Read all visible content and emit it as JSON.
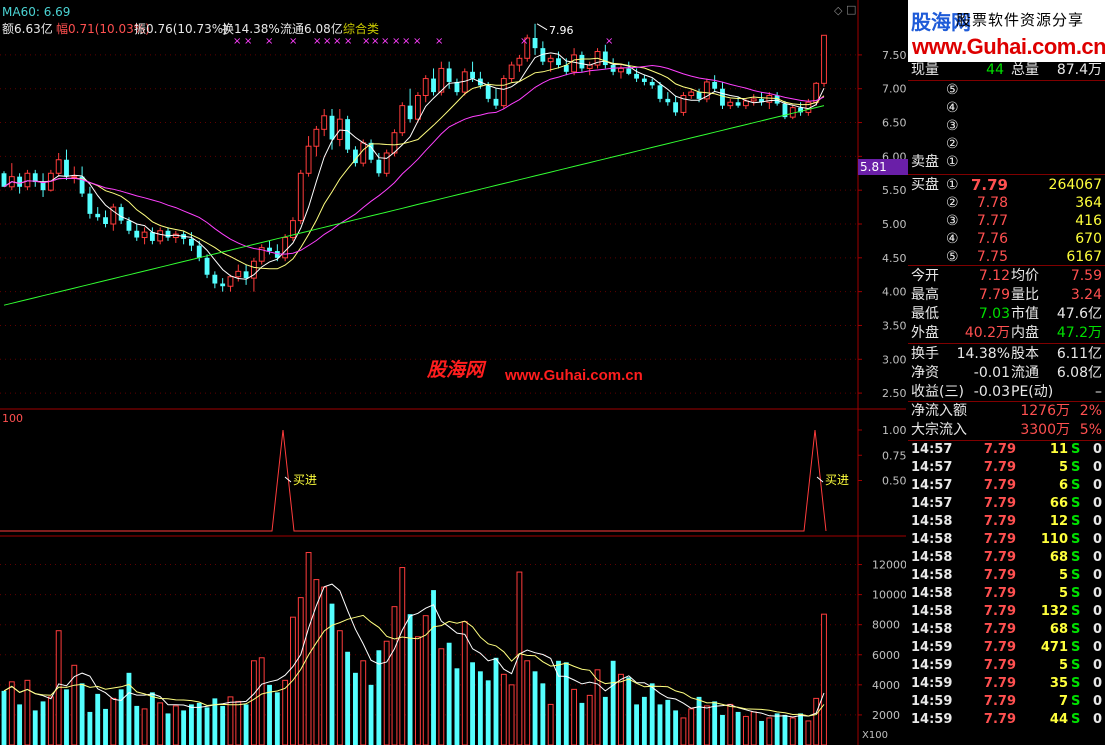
{
  "top_bar": {
    "ma60": "MA60: 6.69",
    "amount": "额6.63亿",
    "change": "幅0.71(10.03%)",
    "amplitude": "振0.76(10.73%)",
    "turnover": "换14.38%",
    "float": "流通6.08亿",
    "sector": "综合类"
  },
  "price_axis": [
    "7.50",
    "7.00",
    "6.50",
    "6.00",
    "5.50",
    "5.00",
    "4.50",
    "4.00",
    "3.50",
    "3.00",
    "2.50"
  ],
  "price_marker": "5.81",
  "high_label": "7.96",
  "indicator": {
    "label": "100",
    "axis": [
      "1.00",
      "0.75",
      "0.50"
    ],
    "signal_text": "买进",
    "signal_color": "#ffff3c"
  },
  "volume": {
    "axis": [
      "12000",
      "10000",
      "8000",
      "6000",
      "4000",
      "2000"
    ],
    "unit": "X100"
  },
  "watermark": {
    "cn": "股海网",
    "url": "www.Guhai.com.cn"
  },
  "logo": {
    "cn": "股海网",
    "tag": "股票软件资源分享",
    "url": "www.Guhai.com.cn"
  },
  "quote": {
    "volume_label": "现量",
    "volume_value": "44",
    "total_label": "总量",
    "total_value": "87.4万",
    "sell_label": "卖盘",
    "sell_levels": [
      "⑤",
      "④",
      "③",
      "②",
      "①"
    ],
    "buy_label": "买盘",
    "buy_levels": [
      {
        "lv": "①",
        "price": "7.79",
        "qty": "264067"
      },
      {
        "lv": "②",
        "price": "7.78",
        "qty": "364"
      },
      {
        "lv": "③",
        "price": "7.77",
        "qty": "416"
      },
      {
        "lv": "④",
        "price": "7.76",
        "qty": "670"
      },
      {
        "lv": "⑤",
        "price": "7.75",
        "qty": "6167"
      }
    ]
  },
  "stats": [
    {
      "l1": "今开",
      "v1": "7.12",
      "c1": "r",
      "l2": "均价",
      "v2": "7.59",
      "c2": "r"
    },
    {
      "l1": "最高",
      "v1": "7.79",
      "c1": "r",
      "l2": "量比",
      "v2": "3.24",
      "c2": "r"
    },
    {
      "l1": "最低",
      "v1": "7.03",
      "c1": "g",
      "l2": "市值",
      "v2": "47.6亿",
      "c2": "w"
    },
    {
      "l1": "外盘",
      "v1": "40.2万",
      "c1": "r",
      "l2": "内盘",
      "v2": "47.2万",
      "c2": "g"
    }
  ],
  "finance": [
    {
      "l1": "换手",
      "v1": "14.38%",
      "l2": "股本",
      "v2": "6.11亿"
    },
    {
      "l1": "净资",
      "v1": "-0.01",
      "l2": "流通",
      "v2": "6.08亿"
    },
    {
      "l1": "收益(三)",
      "v1": "-0.03",
      "l2": "PE(动)",
      "v2": "–"
    }
  ],
  "flow": [
    {
      "label": "净流入额",
      "value": "1276万",
      "pct": "2%"
    },
    {
      "label": "大宗流入",
      "value": "3300万",
      "pct": "5%"
    }
  ],
  "ticks": [
    {
      "t": "14:57",
      "p": "7.79",
      "v": "11",
      "s": "S",
      "n": "0"
    },
    {
      "t": "14:57",
      "p": "7.79",
      "v": "5",
      "s": "S",
      "n": "0"
    },
    {
      "t": "14:57",
      "p": "7.79",
      "v": "6",
      "s": "S",
      "n": "0"
    },
    {
      "t": "14:57",
      "p": "7.79",
      "v": "66",
      "s": "S",
      "n": "0"
    },
    {
      "t": "14:58",
      "p": "7.79",
      "v": "12",
      "s": "S",
      "n": "0"
    },
    {
      "t": "14:58",
      "p": "7.79",
      "v": "110",
      "s": "S",
      "n": "0"
    },
    {
      "t": "14:58",
      "p": "7.79",
      "v": "68",
      "s": "S",
      "n": "0"
    },
    {
      "t": "14:58",
      "p": "7.79",
      "v": "5",
      "s": "S",
      "n": "0"
    },
    {
      "t": "14:58",
      "p": "7.79",
      "v": "5",
      "s": "S",
      "n": "0"
    },
    {
      "t": "14:58",
      "p": "7.79",
      "v": "132",
      "s": "S",
      "n": "0"
    },
    {
      "t": "14:58",
      "p": "7.79",
      "v": "68",
      "s": "S",
      "n": "0"
    },
    {
      "t": "14:59",
      "p": "7.79",
      "v": "471",
      "s": "S",
      "n": "0"
    },
    {
      "t": "14:59",
      "p": "7.79",
      "v": "5",
      "s": "S",
      "n": "0"
    },
    {
      "t": "14:59",
      "p": "7.79",
      "v": "35",
      "s": "S",
      "n": "0"
    },
    {
      "t": "14:59",
      "p": "7.79",
      "v": "7",
      "s": "S",
      "n": "0"
    },
    {
      "t": "14:59",
      "p": "7.79",
      "v": "44",
      "s": "S",
      "n": "0"
    }
  ],
  "chart_data": {
    "type": "candlestick",
    "series": [
      {
        "name": "K",
        "ohlc": [
          [
            5.75,
            5.78,
            5.55,
            5.55
          ],
          [
            5.55,
            5.9,
            5.5,
            5.7
          ],
          [
            5.7,
            5.75,
            5.45,
            5.55
          ],
          [
            5.55,
            5.8,
            5.5,
            5.75
          ],
          [
            5.75,
            5.8,
            5.55,
            5.62
          ],
          [
            5.62,
            5.75,
            5.4,
            5.5
          ],
          [
            5.5,
            5.8,
            5.48,
            5.75
          ],
          [
            5.75,
            6.05,
            5.7,
            5.95
          ],
          [
            5.95,
            6.1,
            5.65,
            5.7
          ],
          [
            5.7,
            5.85,
            5.6,
            5.7
          ],
          [
            5.7,
            5.85,
            5.4,
            5.45
          ],
          [
            5.45,
            5.55,
            5.08,
            5.15
          ],
          [
            5.15,
            5.25,
            5.05,
            5.1
          ],
          [
            5.1,
            5.2,
            4.95,
            5.0
          ],
          [
            5.0,
            5.3,
            4.9,
            5.25
          ],
          [
            5.25,
            5.3,
            5.0,
            5.05
          ],
          [
            5.05,
            5.1,
            4.85,
            4.9
          ],
          [
            4.9,
            5.0,
            4.75,
            4.8
          ],
          [
            4.8,
            4.95,
            4.7,
            4.88
          ],
          [
            4.88,
            4.95,
            4.7,
            4.75
          ],
          [
            4.75,
            4.95,
            4.7,
            4.9
          ],
          [
            4.9,
            4.95,
            4.75,
            4.8
          ],
          [
            4.8,
            4.9,
            4.72,
            4.85
          ],
          [
            4.85,
            4.9,
            4.7,
            4.78
          ],
          [
            4.78,
            4.88,
            4.6,
            4.68
          ],
          [
            4.68,
            4.75,
            4.45,
            4.5
          ],
          [
            4.5,
            4.55,
            4.2,
            4.25
          ],
          [
            4.25,
            4.3,
            4.05,
            4.12
          ],
          [
            4.12,
            4.2,
            4.0,
            4.08
          ],
          [
            4.08,
            4.25,
            4.0,
            4.22
          ],
          [
            4.22,
            4.4,
            4.15,
            4.3
          ],
          [
            4.3,
            4.4,
            4.1,
            4.2
          ],
          [
            4.2,
            4.5,
            4.0,
            4.45
          ],
          [
            4.45,
            4.7,
            4.4,
            4.65
          ],
          [
            4.65,
            4.75,
            4.55,
            4.6
          ],
          [
            4.6,
            4.7,
            4.45,
            4.5
          ],
          [
            4.5,
            4.85,
            4.45,
            4.8
          ],
          [
            4.8,
            5.1,
            4.75,
            5.05
          ],
          [
            5.05,
            5.8,
            5.0,
            5.75
          ],
          [
            5.75,
            6.3,
            5.7,
            6.15
          ],
          [
            6.15,
            6.45,
            6.0,
            6.4
          ],
          [
            6.4,
            6.7,
            6.3,
            6.6
          ],
          [
            6.6,
            6.7,
            6.1,
            6.25
          ],
          [
            6.25,
            6.7,
            6.15,
            6.55
          ],
          [
            6.55,
            6.6,
            6.05,
            6.1
          ],
          [
            6.1,
            6.15,
            5.85,
            5.9
          ],
          [
            5.9,
            6.25,
            5.85,
            6.2
          ],
          [
            6.2,
            6.25,
            5.9,
            5.95
          ],
          [
            5.95,
            6.05,
            5.7,
            5.75
          ],
          [
            5.75,
            6.1,
            5.7,
            6.05
          ],
          [
            6.05,
            6.4,
            6.0,
            6.35
          ],
          [
            6.35,
            6.8,
            6.3,
            6.75
          ],
          [
            6.75,
            7.0,
            6.5,
            6.55
          ],
          [
            6.55,
            6.95,
            6.5,
            6.9
          ],
          [
            6.9,
            7.2,
            6.8,
            7.15
          ],
          [
            7.15,
            7.3,
            6.9,
            6.95
          ],
          [
            6.95,
            7.4,
            6.9,
            7.3
          ],
          [
            7.3,
            7.4,
            7.0,
            7.1
          ],
          [
            7.1,
            7.15,
            6.9,
            6.95
          ],
          [
            6.95,
            7.3,
            6.9,
            7.25
          ],
          [
            7.25,
            7.4,
            7.1,
            7.15
          ],
          [
            7.15,
            7.25,
            7.0,
            7.05
          ],
          [
            7.05,
            7.1,
            6.8,
            6.85
          ],
          [
            6.85,
            7.0,
            6.7,
            6.75
          ],
          [
            6.75,
            7.2,
            6.7,
            7.15
          ],
          [
            7.15,
            7.4,
            7.1,
            7.35
          ],
          [
            7.35,
            7.5,
            7.25,
            7.45
          ],
          [
            7.45,
            7.8,
            7.4,
            7.75
          ],
          [
            7.75,
            7.96,
            7.5,
            7.6
          ],
          [
            7.6,
            7.7,
            7.35,
            7.4
          ],
          [
            7.4,
            7.5,
            7.25,
            7.45
          ],
          [
            7.45,
            7.55,
            7.3,
            7.35
          ],
          [
            7.35,
            7.45,
            7.2,
            7.25
          ],
          [
            7.25,
            7.6,
            7.2,
            7.5
          ],
          [
            7.5,
            7.55,
            7.25,
            7.3
          ],
          [
            7.3,
            7.4,
            7.2,
            7.35
          ],
          [
            7.35,
            7.6,
            7.3,
            7.55
          ],
          [
            7.55,
            7.65,
            7.3,
            7.35
          ],
          [
            7.35,
            7.45,
            7.2,
            7.25
          ],
          [
            7.25,
            7.35,
            7.15,
            7.3
          ],
          [
            7.3,
            7.4,
            7.2,
            7.22
          ],
          [
            7.22,
            7.3,
            7.1,
            7.15
          ],
          [
            7.15,
            7.2,
            7.05,
            7.1
          ],
          [
            7.1,
            7.15,
            7.0,
            7.05
          ],
          [
            7.05,
            7.1,
            6.8,
            6.85
          ],
          [
            6.85,
            6.95,
            6.75,
            6.8
          ],
          [
            6.8,
            6.9,
            6.6,
            6.65
          ],
          [
            6.65,
            6.95,
            6.6,
            6.9
          ],
          [
            6.9,
            7.0,
            6.85,
            6.95
          ],
          [
            6.95,
            7.0,
            6.8,
            6.85
          ],
          [
            6.85,
            7.15,
            6.8,
            7.1
          ],
          [
            7.1,
            7.2,
            6.95,
            7.0
          ],
          [
            7.0,
            7.1,
            6.7,
            6.75
          ],
          [
            6.75,
            6.85,
            6.7,
            6.8
          ],
          [
            6.8,
            6.88,
            6.72,
            6.75
          ],
          [
            6.75,
            6.85,
            6.7,
            6.82
          ],
          [
            6.82,
            6.92,
            6.75,
            6.85
          ],
          [
            6.85,
            6.95,
            6.75,
            6.8
          ],
          [
            6.8,
            6.95,
            6.7,
            6.9
          ],
          [
            6.9,
            6.95,
            6.75,
            6.78
          ],
          [
            6.78,
            6.82,
            6.55,
            6.58
          ],
          [
            6.58,
            6.75,
            6.55,
            6.72
          ],
          [
            6.72,
            6.8,
            6.6,
            6.65
          ],
          [
            6.65,
            6.85,
            6.6,
            6.8
          ],
          [
            6.8,
            7.1,
            6.75,
            7.08
          ],
          [
            7.08,
            7.79,
            7.03,
            7.79
          ]
        ]
      }
    ],
    "volume": [
      3600,
      4200,
      2700,
      4300,
      2300,
      2900,
      3200,
      7600,
      3700,
      5300,
      4100,
      2200,
      3400,
      2400,
      3100,
      3700,
      4800,
      2600,
      2400,
      3500,
      2800,
      2100,
      2600,
      2300,
      2700,
      2800,
      2500,
      3100,
      2600,
      3200,
      2900,
      2700,
      5600,
      5800,
      4000,
      3500,
      4300,
      8500,
      9800,
      12800,
      11000,
      10500,
      9400,
      7600,
      6200,
      4800,
      5600,
      4000,
      6300,
      6900,
      9200,
      11800,
      8700,
      7200,
      8600,
      10300,
      6400,
      6800,
      5100,
      8200,
      5500,
      4900,
      4300,
      5800,
      4700,
      4000,
      11500,
      5600,
      4900,
      4100,
      2700,
      5600,
      5500,
      3700,
      2800,
      3300,
      5000,
      3200,
      5600,
      4700,
      4500,
      2700,
      3200,
      4100,
      2700,
      3000,
      2300,
      1800,
      2400,
      3200,
      2600,
      2900,
      2000,
      2700,
      2200,
      1900,
      2200,
      1600,
      1800,
      2100,
      2000,
      1800,
      2100,
      1600,
      3100,
      8700
    ]
  }
}
